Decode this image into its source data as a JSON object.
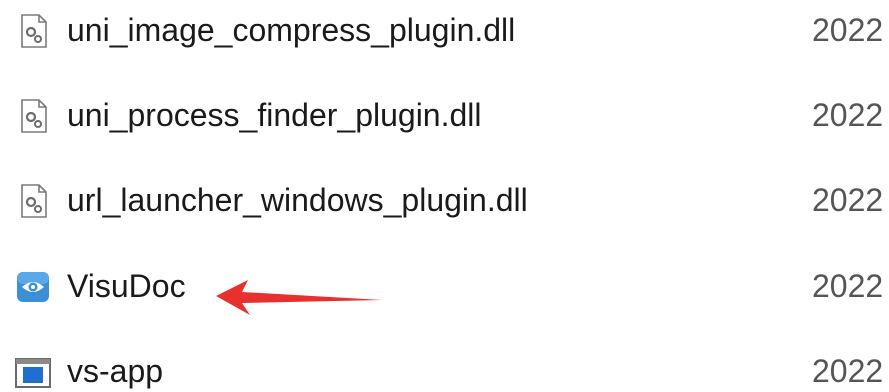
{
  "files": [
    {
      "name": "uni_image_compress_plugin.dll",
      "date": "2022",
      "icon": "dll-gear-icon"
    },
    {
      "name": "uni_process_finder_plugin.dll",
      "date": "2022",
      "icon": "dll-gear-icon"
    },
    {
      "name": "url_launcher_windows_plugin.dll",
      "date": "2022",
      "icon": "dll-gear-icon"
    },
    {
      "name": "VisuDoc",
      "date": "2022",
      "icon": "eye-app-icon"
    },
    {
      "name": "vs-app",
      "date": "2022",
      "icon": "window-app-icon"
    }
  ],
  "colors": {
    "arrow": "#e8312f",
    "eye_icon_bg": "#3a8fd8",
    "window_icon_blue": "#1f6fd1"
  }
}
